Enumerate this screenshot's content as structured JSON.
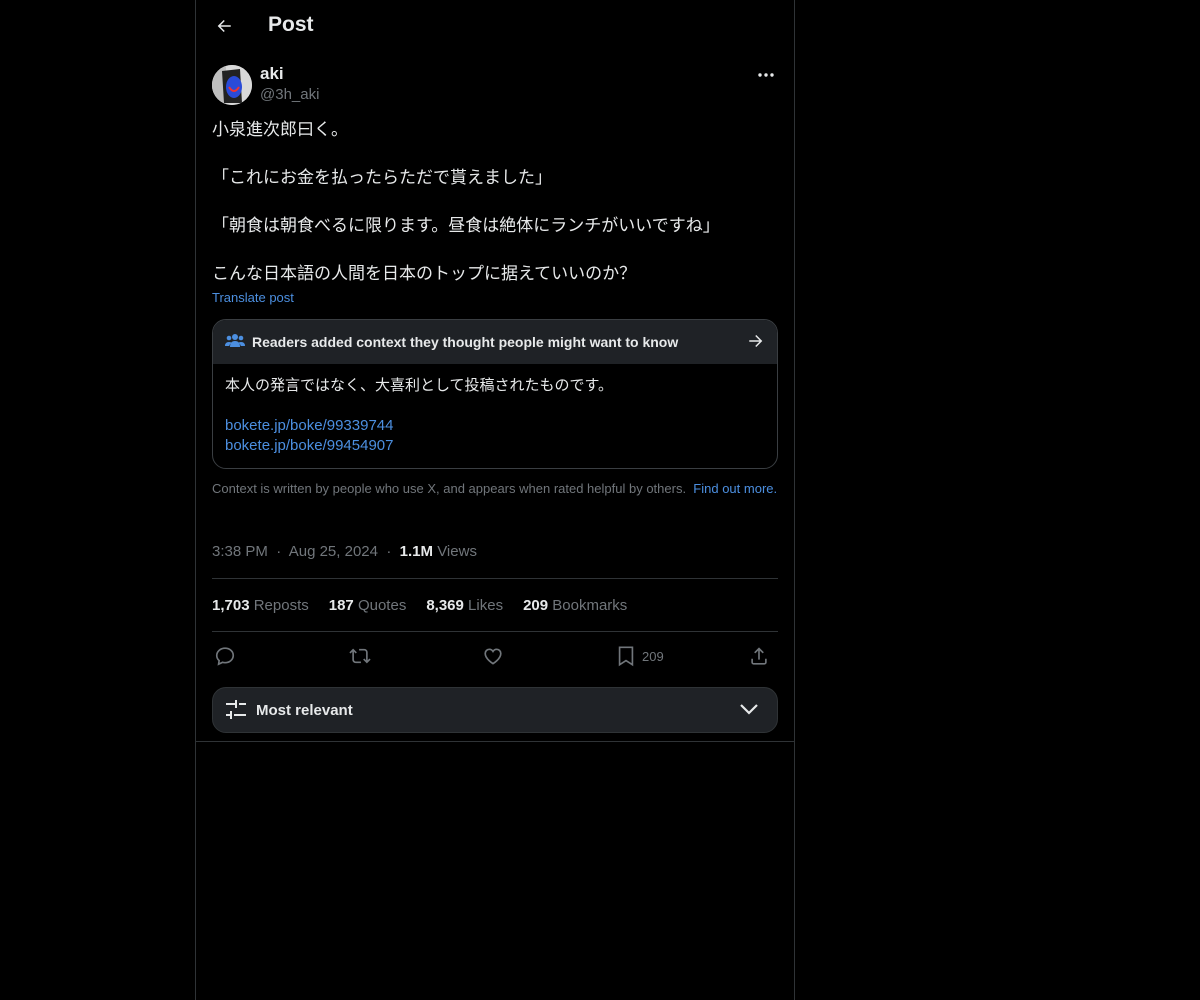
{
  "header": {
    "title": "Post"
  },
  "author": {
    "name": "aki",
    "handle": "@3h_aki"
  },
  "post": {
    "lines": [
      "小泉進次郎曰く。",
      "",
      "「これにお金を払ったらただで貰えました」",
      "",
      "「朝食は朝食べるに限ります。昼食は絶体にランチがいいですね」",
      "",
      "こんな日本語の人間を日本のトップに据えていいのか？"
    ],
    "translate_label": "Translate post"
  },
  "note": {
    "title": "Readers added context they thought people might want to know",
    "text": "本人の発言ではなく、大喜利として投稿されたものです。",
    "links": [
      "bokete.jp/boke/99339744",
      "bokete.jp/boke/99454907"
    ]
  },
  "context": {
    "text": "Context is written by people who use X, and appears when rated helpful by others.",
    "link": "Find out more."
  },
  "meta": {
    "time": "3:38 PM",
    "date": "Aug 25, 2024",
    "views_count": "1.1M",
    "views_label": "Views"
  },
  "stats": {
    "reposts_count": "1,703",
    "reposts_label": "Reposts",
    "quotes_count": "187",
    "quotes_label": "Quotes",
    "likes_count": "8,369",
    "likes_label": "Likes",
    "bookmarks_count": "209",
    "bookmarks_label": "Bookmarks"
  },
  "actions": {
    "bookmark_count": "209"
  },
  "sort": {
    "label": "Most relevant"
  },
  "colors": {
    "accent": "#4c8fe0",
    "muted": "#71767b",
    "text": "#e7e9ea",
    "background": "#000000"
  }
}
